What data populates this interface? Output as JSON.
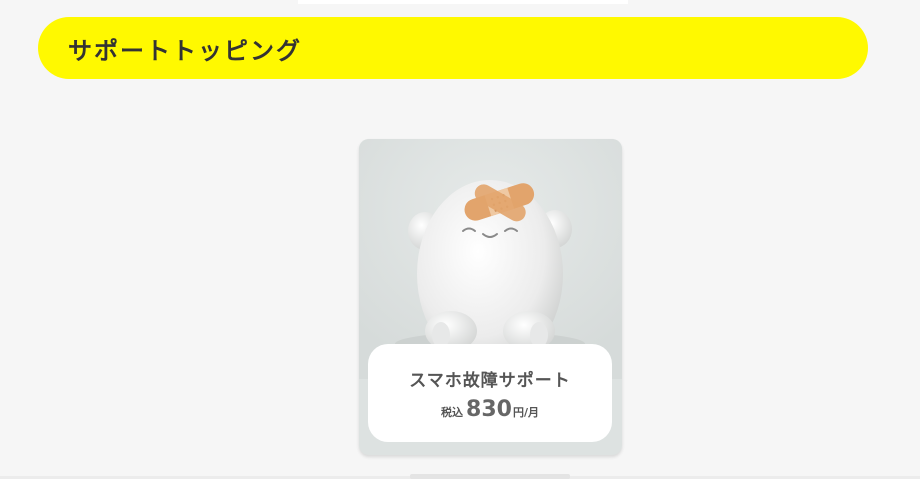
{
  "section": {
    "title": "サポートトッピング"
  },
  "product": {
    "name": "スマホ故障サポート",
    "tax_label": "税込",
    "price": "830",
    "price_unit": "円/月",
    "image_icon": "egg-mascot-with-bandage"
  },
  "colors": {
    "header_bg": "#fff900",
    "page_bg": "#f6f6f6",
    "card_bg": "#dde2e1",
    "text": "#555555",
    "bandage": "#e2a46c"
  }
}
